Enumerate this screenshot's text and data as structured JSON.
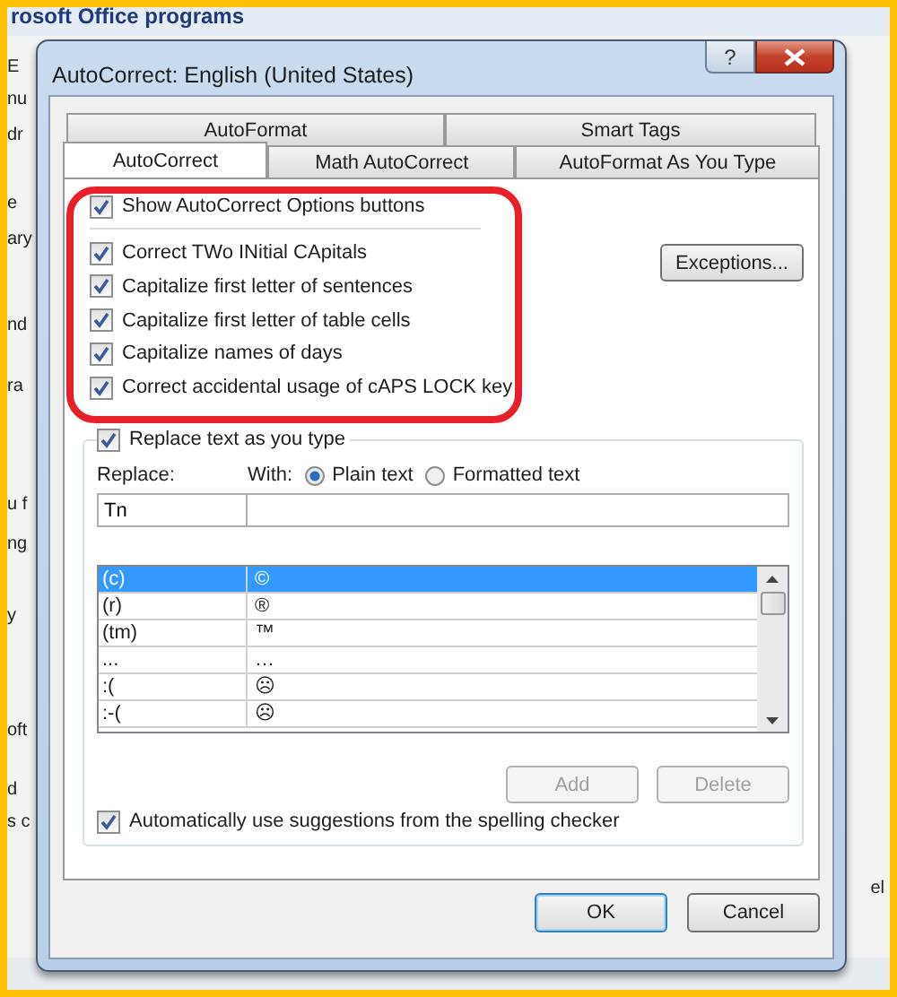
{
  "background_window": {
    "title": "rosoft Office programs",
    "fragments": [
      "E",
      "nu",
      "dr",
      "e",
      "ary",
      "nd",
      "ra",
      "u f",
      "ng",
      "y",
      "oft",
      "d",
      "s c"
    ],
    "right_fragment": "el"
  },
  "dialog": {
    "title": "AutoCorrect: English (United States)",
    "help_button": "?"
  },
  "tabs_row_1": [
    {
      "label": "AutoFormat",
      "selected": false
    },
    {
      "label": "Smart Tags",
      "selected": false
    }
  ],
  "tabs_row_2": [
    {
      "label": "AutoCorrect",
      "selected": true
    },
    {
      "label": "Math AutoCorrect",
      "selected": false
    },
    {
      "label": "AutoFormat As You Type",
      "selected": false
    }
  ],
  "show_options": {
    "label": "Show AutoCorrect Options buttons",
    "checked": true
  },
  "corrections": [
    {
      "label": "Correct TWo INitial CApitals",
      "checked": true
    },
    {
      "label": "Capitalize first letter of sentences",
      "checked": true
    },
    {
      "label": "Capitalize first letter of table cells",
      "checked": true
    },
    {
      "label": "Capitalize names of days",
      "checked": true
    },
    {
      "label": "Correct accidental usage of cAPS LOCK key",
      "checked": true
    }
  ],
  "exceptions_button": "Exceptions...",
  "replace_group": {
    "checkbox": {
      "label": "Replace text as you type",
      "checked": true
    },
    "replace_label": "Replace:",
    "with_label": "With:",
    "format_options": [
      {
        "label": "Plain text",
        "selected": true
      },
      {
        "label": "Formatted text",
        "selected": false
      }
    ],
    "replace_value": "Tn",
    "entries": [
      {
        "replace": "(c)",
        "with": "©",
        "selected": true
      },
      {
        "replace": "(r)",
        "with": "®",
        "selected": false
      },
      {
        "replace": "(tm)",
        "with": "™",
        "selected": false
      },
      {
        "replace": "...",
        "with": "…",
        "selected": false
      },
      {
        "replace": ":(",
        "with": "☹",
        "selected": false
      },
      {
        "replace": ":-(",
        "with": "☹",
        "selected": false
      }
    ],
    "add_button": {
      "label": "Add",
      "disabled": true
    },
    "delete_button": {
      "label": "Delete",
      "disabled": true
    },
    "suggestions": {
      "label": "Automatically use suggestions from the spelling checker",
      "checked": true
    }
  },
  "buttons": [
    {
      "label": "OK",
      "kind": "default"
    },
    {
      "label": "Cancel",
      "kind": "normal"
    }
  ]
}
